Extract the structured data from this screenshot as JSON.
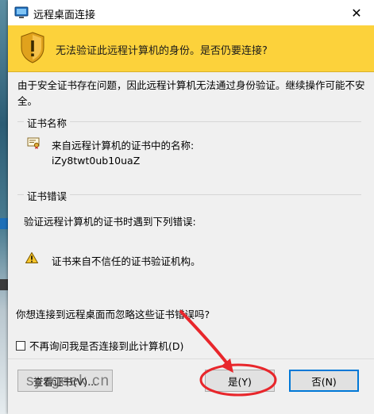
{
  "window": {
    "title": "远程桌面连接",
    "close_glyph": "✕"
  },
  "banner": {
    "message": "无法验证此远程计算机的身份。是否仍要连接?",
    "icon": "shield-warning-icon",
    "color": "#fcd23b"
  },
  "description": "由于安全证书存在问题，因此远程计算机无法通过身份验证。继续操作可能不安全。",
  "certificate_name_group": {
    "label": "证书名称",
    "from_label": "来自远程计算机的证书中的名称:",
    "name": "iZy8twt0ub10uaZ",
    "icon": "certificate-icon"
  },
  "certificate_error_group": {
    "label": "证书错误",
    "intro": "验证远程计算机的证书时遇到下列错误:",
    "errors": [
      "证书来自不信任的证书验证机构。"
    ],
    "icon": "warning-icon"
  },
  "question": "你想连接到远程桌面而忽略这些证书错误吗?",
  "dont_ask": {
    "label": "不再询问我是否连接到此计算机(D)",
    "checked": false
  },
  "buttons": {
    "view_cert": "查看证书(V)...",
    "yes": "是(Y)",
    "no": "否(N)"
  },
  "watermark": "sysgeek.cn",
  "annotation_color": "#e8262b"
}
